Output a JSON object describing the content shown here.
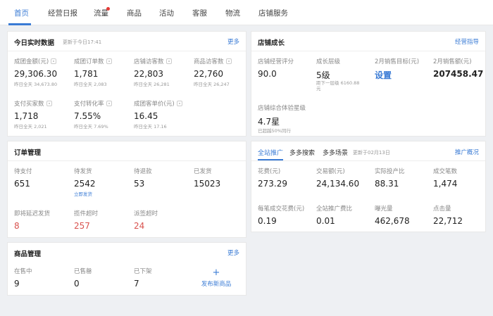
{
  "nav": {
    "items": [
      "首页",
      "经营日报",
      "流量",
      "商品",
      "活动",
      "客服",
      "物流",
      "店铺服务"
    ]
  },
  "realtime": {
    "title": "今日实时数据",
    "updated": "更新于今日17:41",
    "more": "更多",
    "metrics": [
      {
        "label": "成团金额(元)",
        "value": "29,306.30",
        "sub": "昨日全天 34,673.80"
      },
      {
        "label": "成团订单数",
        "value": "1,781",
        "sub": "昨日全天 2,083"
      },
      {
        "label": "店铺访客数",
        "value": "22,803",
        "sub": "昨日全天 26,281"
      },
      {
        "label": "商品访客数",
        "value": "22,760",
        "sub": "昨日全天 26,247"
      },
      {
        "label": "支付买家数",
        "value": "1,718",
        "sub": "昨日全天 2,021"
      },
      {
        "label": "支付转化率",
        "value": "7.55%",
        "sub": "昨日全天 7.69%"
      },
      {
        "label": "成团客单价(元)",
        "value": "16.45",
        "sub": "昨日全天 17.16"
      }
    ]
  },
  "growth": {
    "title": "店铺成长",
    "link": "经营指导",
    "metrics": [
      {
        "label": "店铺经营评分",
        "value": "90.0"
      },
      {
        "label": "成长层级",
        "value": "5级",
        "sub": "距下一层级 6160.88元"
      },
      {
        "label": "2月销售目标(元)",
        "value": "设置"
      },
      {
        "label": "2月销售额(元)",
        "value": "207458.47"
      },
      {
        "label": "店铺综合体验星级",
        "value": "4.7星",
        "sub": "已超越50%同行"
      }
    ]
  },
  "orders": {
    "title": "订单管理",
    "metrics": [
      {
        "label": "待支付",
        "value": "651"
      },
      {
        "label": "待发货",
        "value": "2542",
        "sub": "立即发货"
      },
      {
        "label": "待退款",
        "value": "53"
      },
      {
        "label": "已发货",
        "value": "15023"
      },
      {
        "label": "即将延迟发货",
        "value": "8"
      },
      {
        "label": "揽件超时",
        "value": "257"
      },
      {
        "label": "派签超时",
        "value": "24"
      }
    ]
  },
  "promo": {
    "tabs": [
      "全站推广",
      "多多搜索",
      "多多场景"
    ],
    "updated": "更新于02月13日",
    "link": "推广概况",
    "metrics": [
      {
        "label": "花费(元)",
        "value": "273.29"
      },
      {
        "label": "交易额(元)",
        "value": "24,134.60"
      },
      {
        "label": "实际投产比",
        "value": "88.31"
      },
      {
        "label": "成交笔数",
        "value": "1,474"
      },
      {
        "label": "每笔成交花费(元)",
        "value": "0.19"
      },
      {
        "label": "全站推广费比",
        "value": "0.01"
      },
      {
        "label": "曝光量",
        "value": "462,678"
      },
      {
        "label": "点击量",
        "value": "22,712"
      }
    ]
  },
  "products": {
    "title": "商品管理",
    "more": "更多",
    "metrics": [
      {
        "label": "在售中",
        "value": "9"
      },
      {
        "label": "已售罄",
        "value": "0"
      },
      {
        "label": "已下架",
        "value": "7"
      }
    ],
    "add": {
      "plus": "+",
      "label": "发布新商品"
    }
  },
  "colors": {
    "accent": "#3a7bd5",
    "alert": "#d9534f",
    "background": "#eef0f3"
  }
}
